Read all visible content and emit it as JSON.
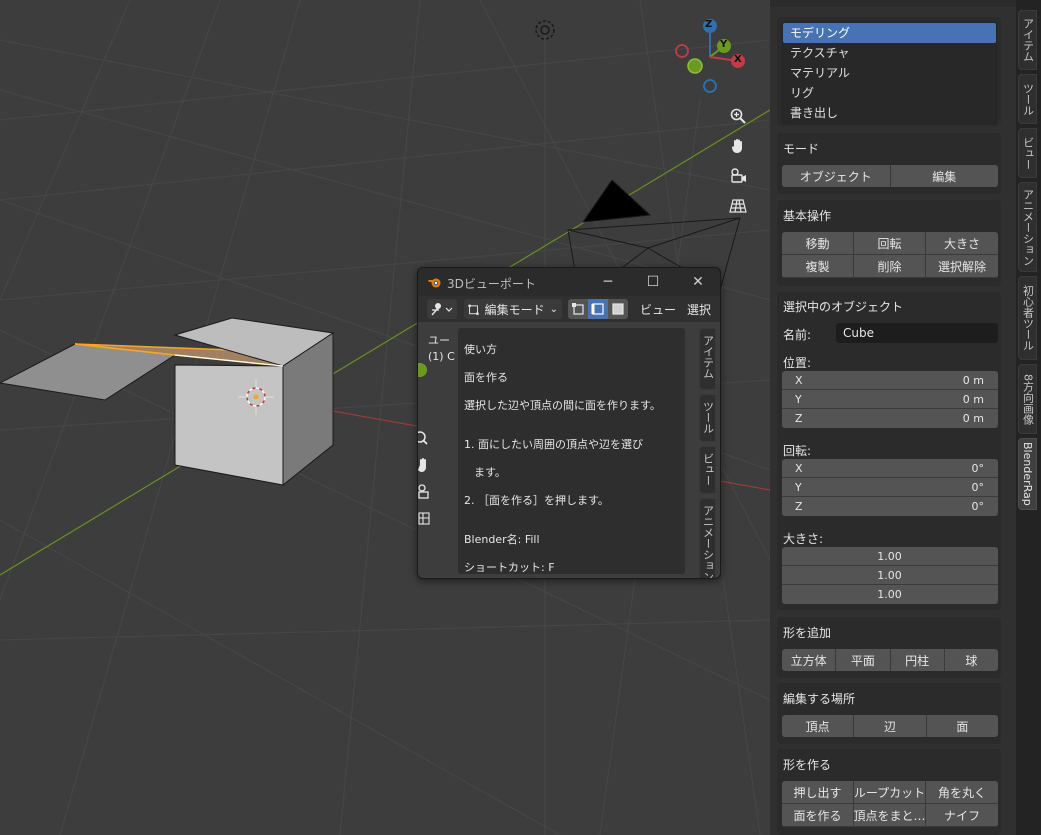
{
  "viewport": {
    "colors": {
      "background": "#3d3d3d",
      "grid_line": "#474747",
      "x_axis": "#9c3a3a",
      "y_axis": "#6b8e23",
      "selection": "#f5a623"
    },
    "gizmo": {
      "z_label": "Z",
      "y_label": "Y",
      "x_label": "X"
    },
    "nav_icons": [
      "zoom-icon",
      "pan-hand-icon",
      "camera-icon",
      "grid-view-icon"
    ]
  },
  "side_panel": {
    "categories": [
      "モデリング",
      "テクスチャ",
      "マテリアル",
      "リグ",
      "書き出し"
    ],
    "active_category": "モデリング",
    "mode": {
      "title": "モード",
      "buttons": [
        "オブジェクト",
        "編集"
      ]
    },
    "basic_ops": {
      "title": "基本操作",
      "buttons": [
        "移動",
        "回転",
        "大きさ",
        "複製",
        "削除",
        "選択解除"
      ]
    },
    "selected_object": {
      "title": "選択中のオブジェクト",
      "name_label": "名前:",
      "name_value": "Cube",
      "location_label": "位置:",
      "location": [
        {
          "axis": "X",
          "value": "0 m"
        },
        {
          "axis": "Y",
          "value": "0 m"
        },
        {
          "axis": "Z",
          "value": "0 m"
        }
      ],
      "rotation_label": "回転:",
      "rotation": [
        {
          "axis": "X",
          "value": "0°"
        },
        {
          "axis": "Y",
          "value": "0°"
        },
        {
          "axis": "Z",
          "value": "0°"
        }
      ],
      "scale_label": "大きさ:",
      "scale": [
        "1.00",
        "1.00",
        "1.00"
      ]
    },
    "add_shape": {
      "title": "形を追加",
      "buttons": [
        "立方体",
        "平面",
        "円柱",
        "球"
      ]
    },
    "edit_target": {
      "title": "編集する場所",
      "buttons": [
        "頂点",
        "辺",
        "面"
      ]
    },
    "make_shape": {
      "title": "形を作る",
      "buttons": [
        "押し出す",
        "ループカット",
        "角を丸く",
        "面を作る",
        "頂点をまと…",
        "ナイフ"
      ]
    }
  },
  "tab_strip": {
    "tabs": [
      "アイテム",
      "ツール",
      "ビュー",
      "アニメーション",
      "初心者ツール",
      "8方向画像",
      "BlenderRap"
    ],
    "active_tab": "BlenderRap"
  },
  "float_window": {
    "title": "3Dビューポート",
    "minimize": "─",
    "maximize": "☐",
    "close": "✕",
    "mode_dropdown": "編集モード",
    "menu_view": "ビュー",
    "menu_select": "選択",
    "partial_overlay_1": "ユー",
    "partial_overlay_2": "(1) C",
    "help": {
      "heading": "使い方",
      "op_name": "面を作る",
      "description": "選択した辺や頂点の間に面を作ります。",
      "step1a": "1. 面にしたい周囲の頂点や辺を選び",
      "step1b": "ます。",
      "step2": "2. ［面を作る］を押します。",
      "blender_name": "Blender名: Fill",
      "shortcut": "ショートカット: F"
    },
    "tabs": [
      "アイテム",
      "ツール",
      "ビュー",
      "アニメーション"
    ]
  }
}
